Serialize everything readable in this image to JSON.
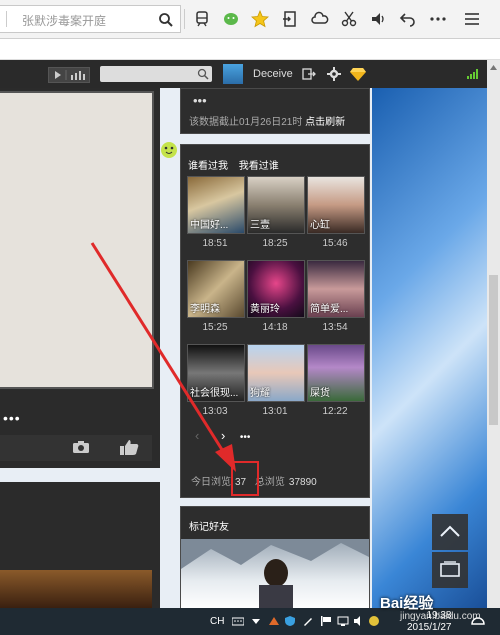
{
  "browser": {
    "search_placeholder": "张默涉毒案开庭"
  },
  "header": {
    "username": "Deceive"
  },
  "panel_top": {
    "info_text": "该数据截止01月26日21时",
    "refresh_link": "点击刷新"
  },
  "visitors": {
    "tab_who_viewed_me": "谁看过我",
    "tab_i_viewed": "我看过谁",
    "items": [
      {
        "name": "中国好...",
        "time": "18:51"
      },
      {
        "name": "三壹",
        "time": "18:25"
      },
      {
        "name": "心缸",
        "time": "15:46"
      },
      {
        "name": "李明森",
        "time": "15:25"
      },
      {
        "name": "黄丽玲",
        "time": "14:18"
      },
      {
        "name": "简单爱...",
        "time": "13:54"
      },
      {
        "name": "社会很现...",
        "time": "13:03"
      },
      {
        "name": "狗耀",
        "time": "13:01"
      },
      {
        "name": "屎货",
        "time": "12:22"
      }
    ],
    "today_label": "今日浏览",
    "today_count": "37",
    "total_label": "总浏览",
    "total_count": "37890"
  },
  "mark_friends": {
    "title": "标记好友"
  },
  "taskbar": {
    "lang": "CH",
    "time": "19:38",
    "date": "2015/1/27"
  },
  "watermark": {
    "brand": "Bai经验",
    "url": "jingyan.baidu.com"
  },
  "colors": {
    "highlight_box": "#e02a2a",
    "arrow": "#e02a2a"
  }
}
